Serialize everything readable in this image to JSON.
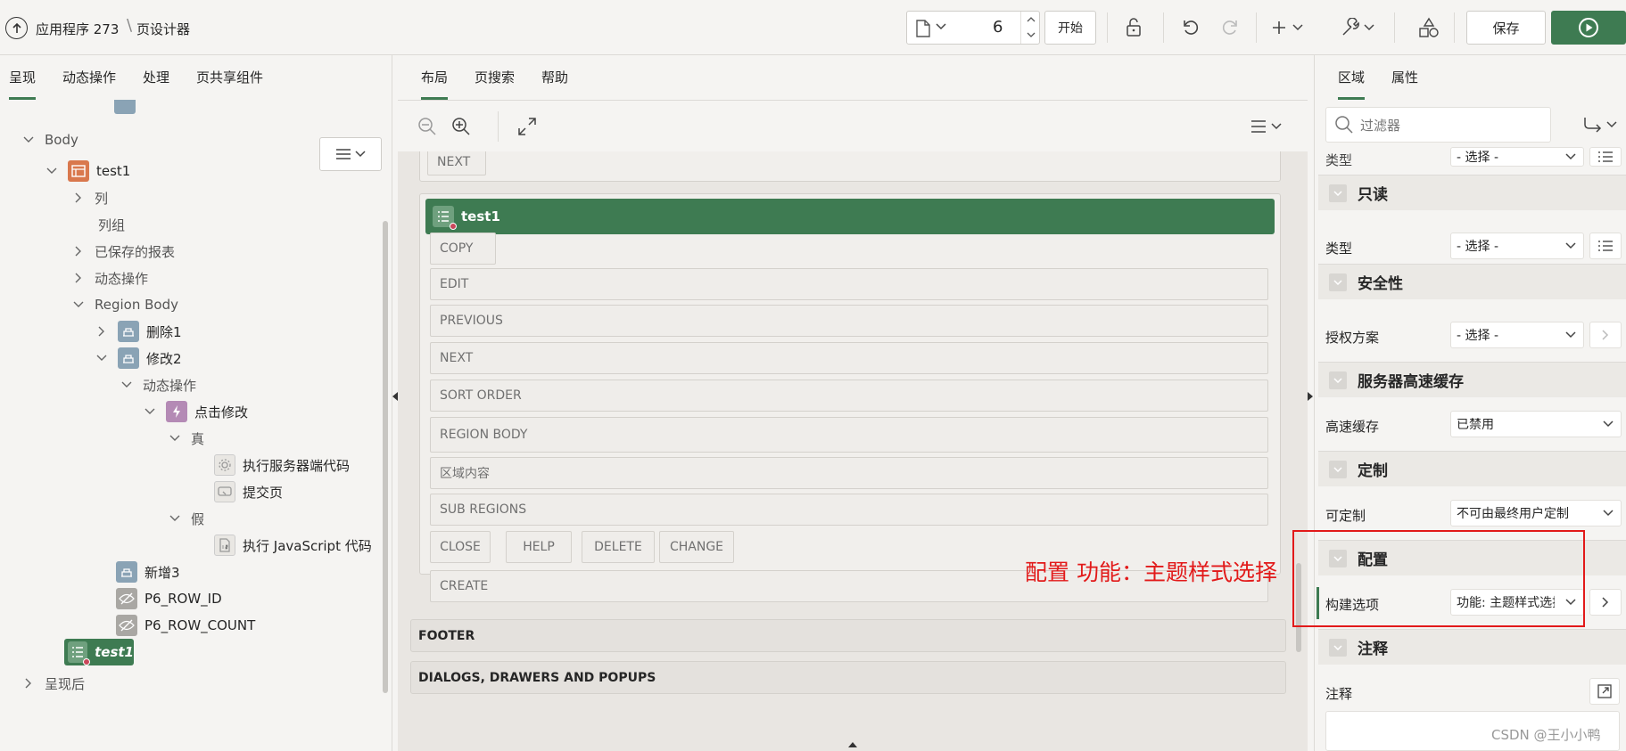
{
  "header": {
    "app_name": "应用程序 273",
    "separator": "\\",
    "page_designer": "页设计器",
    "page_number": "6",
    "start_button": "开始",
    "save_button": "保存"
  },
  "left": {
    "tabs": [
      "呈现",
      "动态操作",
      "处理",
      "页共享组件"
    ],
    "tree": {
      "body": "Body",
      "test1": "test1",
      "columns": "列",
      "column_groups": "列组",
      "saved_reports": "已保存的报表",
      "dynamic_actions": "动态操作",
      "region_body": "Region Body",
      "delete1": "删除1",
      "modify2": "修改2",
      "dynamic_actions2": "动态操作",
      "click_modify": "点击修改",
      "true_label": "真",
      "exec_server_code": "执行服务器端代码",
      "submit_page": "提交页",
      "false_label": "假",
      "exec_js": "执行 JavaScript 代码",
      "add3": "新增3",
      "row_id": "P6_ROW_ID",
      "row_count": "P6_ROW_COUNT",
      "test1_selected": "test1",
      "after_header": "呈现后"
    }
  },
  "center": {
    "tabs": [
      "布局",
      "页搜索",
      "帮助"
    ],
    "canvas": {
      "next_top": "NEXT",
      "region_title": "test1",
      "copy": "COPY",
      "edit": "EDIT",
      "previous": "PREVIOUS",
      "next": "NEXT",
      "sort_order": "SORT ORDER",
      "region_body": "REGION BODY",
      "region_content": "区域内容",
      "sub_regions": "SUB REGIONS",
      "close": "CLOSE",
      "help": "HELP",
      "delete": "DELETE",
      "change": "CHANGE",
      "create": "CREATE",
      "footer": "FOOTER",
      "dialogs": "DIALOGS, DRAWERS AND POPUPS"
    },
    "annotation": "配置 功能：主题样式选择"
  },
  "right": {
    "tabs": [
      "区域",
      "属性"
    ],
    "filter_placeholder": "过滤器",
    "top_type_label": "类型",
    "top_type_value": "- 选择 -",
    "sections": {
      "readonly": "只读",
      "security": "安全性",
      "server_cache": "服务器高速缓存",
      "customization": "定制",
      "configuration": "配置",
      "comments": "注释"
    },
    "props": {
      "readonly_type_label": "类型",
      "readonly_type_value": "- 选择 -",
      "auth_label": "授权方案",
      "auth_value": "- 选择 -",
      "cache_label": "高速缓存",
      "cache_value": "已禁用",
      "customizable_label": "可定制",
      "customizable_value": "不可由最终用户定制",
      "build_option_label": "构建选项",
      "build_option_value": "功能: 主题样式选择",
      "comments_label": "注释"
    }
  },
  "watermark": "CSDN @王小小鸭",
  "colors": {
    "accent": "#3e7b52",
    "annotation": "#e21a1a"
  }
}
